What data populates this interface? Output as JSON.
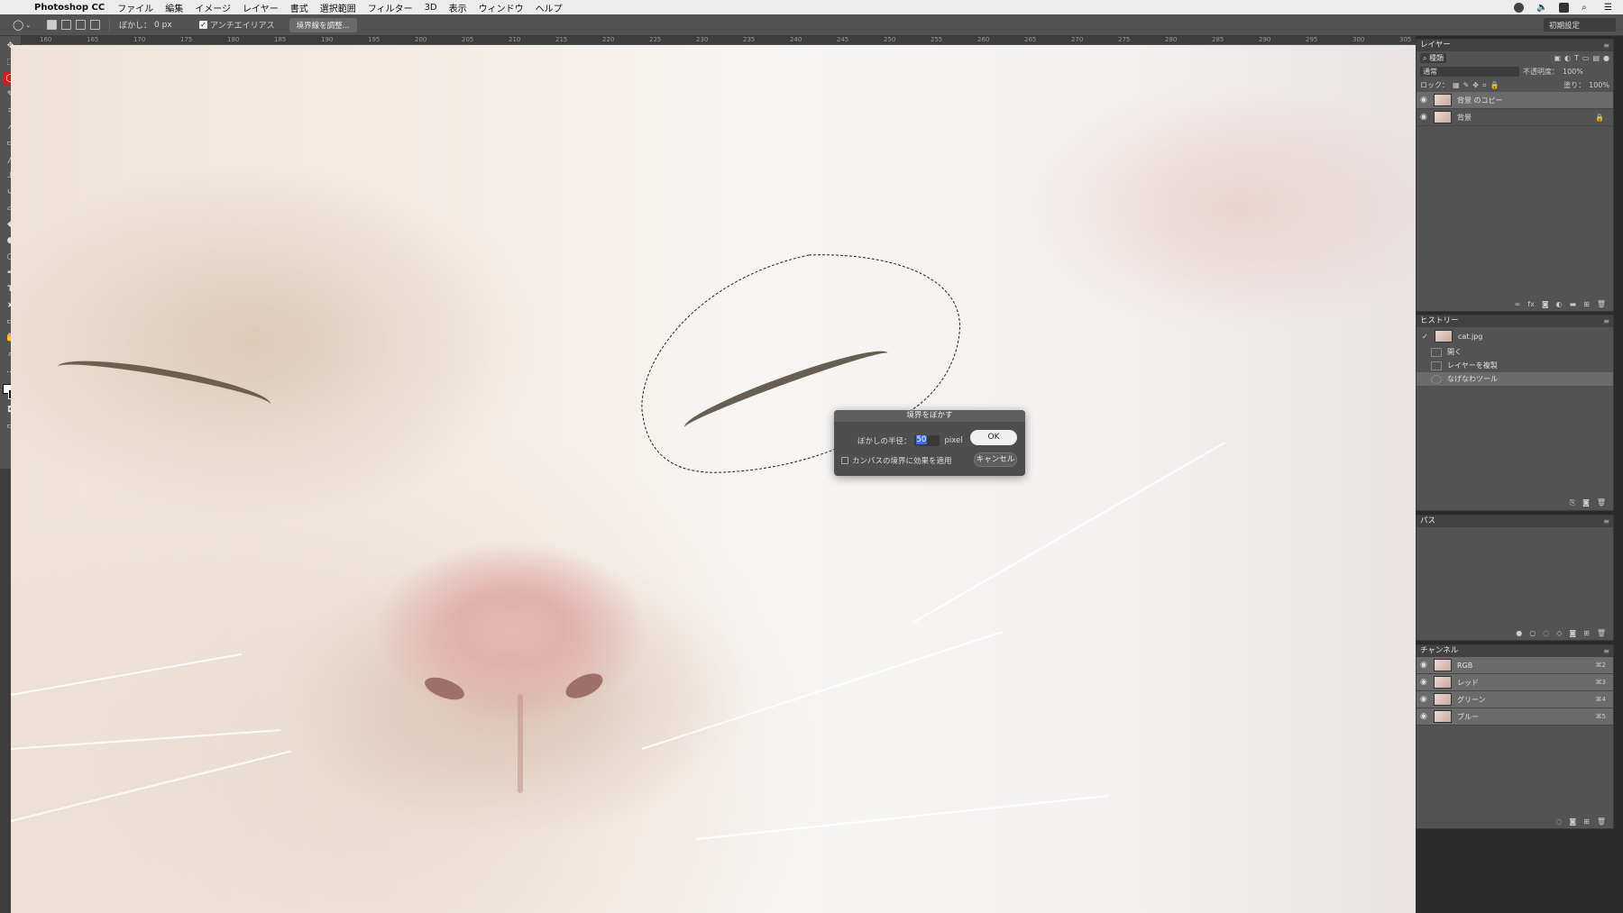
{
  "menubar": {
    "app_name": "Photoshop CC",
    "items": [
      "ファイル",
      "編集",
      "イメージ",
      "レイヤー",
      "書式",
      "選択範囲",
      "フィルター",
      "3D",
      "表示",
      "ウィンドウ",
      "ヘルプ"
    ]
  },
  "options_bar": {
    "feather_label": "ぼかし：",
    "feather_value": "0 px",
    "antialias_label": "アンチエイリアス",
    "antialias_checked": true,
    "refine_edge_label": "境界線を調整...",
    "workspace_preset": "初期設定"
  },
  "ruler_ticks": [
    "160",
    "165",
    "170",
    "175",
    "180",
    "185",
    "190",
    "195",
    "200",
    "205",
    "210",
    "215",
    "220",
    "225",
    "230",
    "235",
    "240",
    "245",
    "250",
    "255",
    "260",
    "265",
    "270",
    "275",
    "280",
    "285",
    "290",
    "295",
    "300",
    "305"
  ],
  "dialog": {
    "title": "境界をぼかす",
    "radius_label": "ぼかしの半径：",
    "radius_value": "50",
    "unit": "pixel",
    "canvas_bounds_label": "カンバスの境界に効果を適用",
    "ok_label": "OK",
    "cancel_label": "キャンセル"
  },
  "layers_panel": {
    "title": "レイヤー",
    "kind_filter": "種類",
    "blend_mode": "通常",
    "opacity_label": "不透明度：",
    "opacity_value": "100%",
    "lock_label": "ロック：",
    "fill_label": "塗り：",
    "fill_value": "100%",
    "layers": [
      {
        "name": "背景 のコピー",
        "selected": true,
        "locked": false
      },
      {
        "name": "背景",
        "selected": false,
        "locked": true
      }
    ]
  },
  "history_panel": {
    "title": "ヒストリー",
    "snapshot": "cat.jpg",
    "states": [
      {
        "name": "開く",
        "selected": false
      },
      {
        "name": "レイヤーを複製",
        "selected": false
      },
      {
        "name": "なげなわツール",
        "selected": true
      }
    ]
  },
  "paths_panel": {
    "title": "パス"
  },
  "channels_panel": {
    "title": "チャンネル",
    "channels": [
      {
        "name": "RGB",
        "shortcut": "⌘2"
      },
      {
        "name": "レッド",
        "shortcut": "⌘3"
      },
      {
        "name": "グリーン",
        "shortcut": "⌘4"
      },
      {
        "name": "ブルー",
        "shortcut": "⌘5"
      }
    ]
  },
  "colors": {
    "active_tool": "#cc1e1e",
    "selection_highlight": "#3d6fd8"
  }
}
